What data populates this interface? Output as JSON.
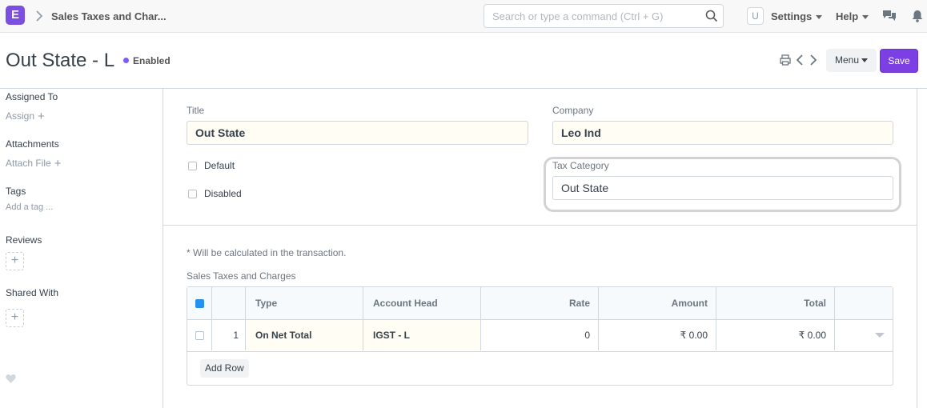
{
  "app": {
    "logo_letter": "E",
    "breadcrumb": "Sales Taxes and Char..."
  },
  "search": {
    "placeholder": "Search or type a command (Ctrl + G)"
  },
  "navbar": {
    "avatar_initial": "U",
    "settings": "Settings",
    "help": "Help"
  },
  "page": {
    "title": "Out State - L",
    "status": "Enabled",
    "menu": "Menu",
    "save": "Save"
  },
  "sidebar": {
    "assigned_to": "Assigned To",
    "assign": "Assign",
    "attachments": "Attachments",
    "attach_file": "Attach File",
    "tags": "Tags",
    "add_tag": "Add a tag ...",
    "reviews": "Reviews",
    "shared_with": "Shared With"
  },
  "form": {
    "title_label": "Title",
    "title_value": "Out State",
    "company_label": "Company",
    "company_value": "Leo Ind",
    "default_label": "Default",
    "disabled_label": "Disabled",
    "tax_category_label": "Tax Category",
    "tax_category_value": "Out State",
    "note": "* Will be calculated in the transaction.",
    "section_label": "Sales Taxes and Charges"
  },
  "table": {
    "headers": {
      "type": "Type",
      "account_head": "Account Head",
      "rate": "Rate",
      "amount": "Amount",
      "total": "Total"
    },
    "rows": [
      {
        "idx": "1",
        "type": "On Net Total",
        "account_head": "IGST - L",
        "rate": "0",
        "amount": "₹ 0.00",
        "total": "₹ 0.00"
      }
    ],
    "add_row": "Add Row"
  },
  "colors": {
    "brand": "#7b4fe0",
    "save": "#7b3fe4",
    "status_dot": "#7c5cff",
    "checkbox": "#2490ef"
  }
}
